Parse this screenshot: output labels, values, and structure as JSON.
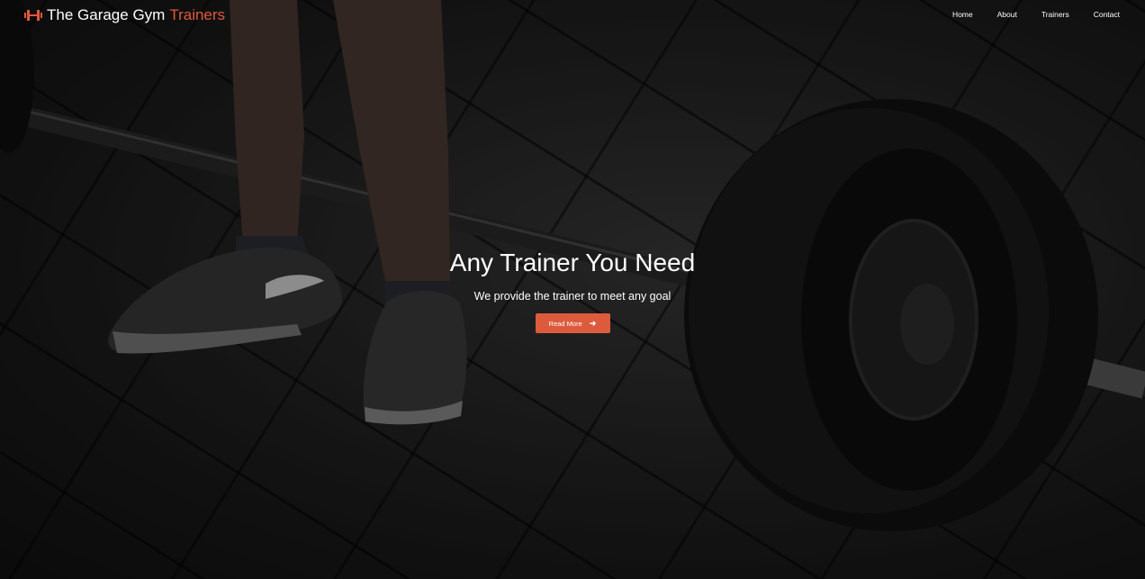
{
  "brand": {
    "name": "The Garage Gym",
    "accent": "Trainers",
    "icon": "dumbbell-icon",
    "accent_color": "#e0593d"
  },
  "nav": {
    "items": [
      {
        "label": "Home"
      },
      {
        "label": "About"
      },
      {
        "label": "Trainers"
      },
      {
        "label": "Contact"
      }
    ]
  },
  "hero": {
    "background": "gym floor with barbell and athlete feet",
    "title": "Any Trainer You Need",
    "subtitle": "We provide the trainer to meet any goal",
    "button": {
      "label": "Read More",
      "icon": "arrow-right-icon",
      "color": "#dc5b3d"
    }
  }
}
